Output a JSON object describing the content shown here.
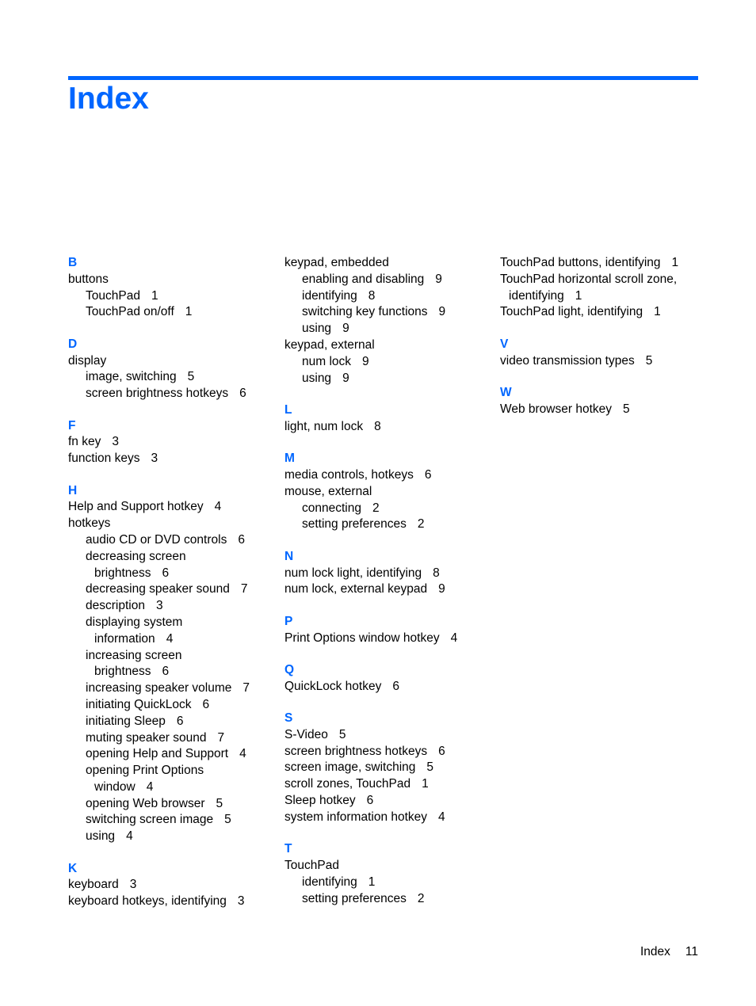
{
  "page": {
    "title": "Index",
    "accent_color": "#0066ff"
  },
  "columns": [
    {
      "sections": [
        {
          "letter": "B",
          "entries": [
            {
              "text": "buttons",
              "page": "",
              "level": 1
            },
            {
              "text": "TouchPad",
              "page": "1",
              "level": 2
            },
            {
              "text": "TouchPad on/off",
              "page": "1",
              "level": 2
            }
          ]
        },
        {
          "letter": "D",
          "entries": [
            {
              "text": "display",
              "page": "",
              "level": 1
            },
            {
              "text": "image, switching",
              "page": "5",
              "level": 2
            },
            {
              "text": "screen brightness hotkeys",
              "page": "6",
              "level": 2
            }
          ]
        },
        {
          "letter": "F",
          "entries": [
            {
              "text": "fn key",
              "page": "3",
              "level": 1
            },
            {
              "text": "function keys",
              "page": "3",
              "level": 1
            }
          ]
        },
        {
          "letter": "H",
          "entries": [
            {
              "text": "Help and Support hotkey",
              "page": "4",
              "level": 1
            },
            {
              "text": "hotkeys",
              "page": "",
              "level": 1
            },
            {
              "text": "audio CD or DVD controls",
              "page": "6",
              "level": 2
            },
            {
              "text": "decreasing screen",
              "page": "",
              "level": 2
            },
            {
              "text": "brightness",
              "page": "6",
              "level": "cont2"
            },
            {
              "text": "decreasing speaker sound",
              "page": "7",
              "level": 2
            },
            {
              "text": "description",
              "page": "3",
              "level": 2
            },
            {
              "text": "displaying system",
              "page": "",
              "level": 2
            },
            {
              "text": "information",
              "page": "4",
              "level": "cont2"
            },
            {
              "text": "increasing screen",
              "page": "",
              "level": 2
            },
            {
              "text": "brightness",
              "page": "6",
              "level": "cont2"
            },
            {
              "text": "increasing speaker volume",
              "page": "7",
              "level": 2
            },
            {
              "text": "initiating QuickLock",
              "page": "6",
              "level": 2
            },
            {
              "text": "initiating Sleep",
              "page": "6",
              "level": 2
            },
            {
              "text": "muting speaker sound",
              "page": "7",
              "level": 2
            },
            {
              "text": "opening Help and Support",
              "page": "4",
              "level": 2
            },
            {
              "text": "opening Print Options",
              "page": "",
              "level": 2
            },
            {
              "text": "window",
              "page": "4",
              "level": "cont2"
            },
            {
              "text": "opening Web browser",
              "page": "5",
              "level": 2
            },
            {
              "text": "switching screen image",
              "page": "5",
              "level": 2
            },
            {
              "text": "using",
              "page": "4",
              "level": 2
            }
          ]
        },
        {
          "letter": "K",
          "entries": [
            {
              "text": "keyboard",
              "page": "3",
              "level": 1
            },
            {
              "text": "keyboard hotkeys, identifying",
              "page": "3",
              "level": 1
            }
          ]
        }
      ]
    },
    {
      "sections": [
        {
          "letter": "",
          "entries": [
            {
              "text": "keypad, embedded",
              "page": "",
              "level": 1
            },
            {
              "text": "enabling and disabling",
              "page": "9",
              "level": 2
            },
            {
              "text": "identifying",
              "page": "8",
              "level": 2
            },
            {
              "text": "switching key functions",
              "page": "9",
              "level": 2
            },
            {
              "text": "using",
              "page": "9",
              "level": 2
            },
            {
              "text": "keypad, external",
              "page": "",
              "level": 1
            },
            {
              "text": "num lock",
              "page": "9",
              "level": 2
            },
            {
              "text": "using",
              "page": "9",
              "level": 2
            }
          ]
        },
        {
          "letter": "L",
          "entries": [
            {
              "text": "light, num lock",
              "page": "8",
              "level": 1
            }
          ]
        },
        {
          "letter": "M",
          "entries": [
            {
              "text": "media controls, hotkeys",
              "page": "6",
              "level": 1
            },
            {
              "text": "mouse, external",
              "page": "",
              "level": 1
            },
            {
              "text": "connecting",
              "page": "2",
              "level": 2
            },
            {
              "text": "setting preferences",
              "page": "2",
              "level": 2
            }
          ]
        },
        {
          "letter": "N",
          "entries": [
            {
              "text": "num lock light, identifying",
              "page": "8",
              "level": 1
            },
            {
              "text": "num lock, external keypad",
              "page": "9",
              "level": 1
            }
          ]
        },
        {
          "letter": "P",
          "entries": [
            {
              "text": "Print Options window hotkey",
              "page": "4",
              "level": 1
            }
          ]
        },
        {
          "letter": "Q",
          "entries": [
            {
              "text": "QuickLock hotkey",
              "page": "6",
              "level": 1
            }
          ]
        },
        {
          "letter": "S",
          "entries": [
            {
              "text": "S-Video",
              "page": "5",
              "level": 1
            },
            {
              "text": "screen brightness hotkeys",
              "page": "6",
              "level": 1
            },
            {
              "text": "screen image, switching",
              "page": "5",
              "level": 1
            },
            {
              "text": "scroll zones, TouchPad",
              "page": "1",
              "level": 1
            },
            {
              "text": "Sleep hotkey",
              "page": "6",
              "level": 1
            },
            {
              "text": "system information hotkey",
              "page": "4",
              "level": 1
            }
          ]
        },
        {
          "letter": "T",
          "entries": [
            {
              "text": "TouchPad",
              "page": "",
              "level": 1
            },
            {
              "text": "identifying",
              "page": "1",
              "level": 2
            },
            {
              "text": "setting preferences",
              "page": "2",
              "level": 2
            }
          ]
        }
      ]
    },
    {
      "sections": [
        {
          "letter": "",
          "entries": [
            {
              "text": "TouchPad buttons, identifying",
              "page": "1",
              "level": 1
            },
            {
              "text": "TouchPad horizontal scroll zone,",
              "page": "",
              "level": 1
            },
            {
              "text": "identifying",
              "page": "1",
              "level": "cont1"
            },
            {
              "text": "TouchPad light, identifying",
              "page": "1",
              "level": 1
            }
          ]
        },
        {
          "letter": "V",
          "entries": [
            {
              "text": "video transmission types",
              "page": "5",
              "level": 1
            }
          ]
        },
        {
          "letter": "W",
          "entries": [
            {
              "text": "Web browser hotkey",
              "page": "5",
              "level": 1
            }
          ]
        }
      ]
    }
  ],
  "footer": {
    "label": "Index",
    "page_number": "11"
  }
}
